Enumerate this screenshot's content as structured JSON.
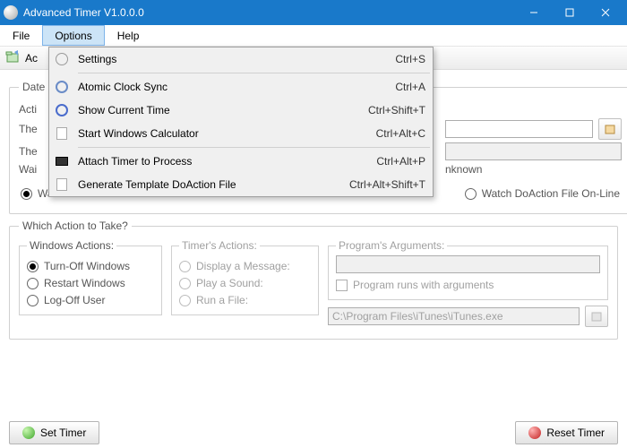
{
  "window": {
    "title": "Advanced Timer V1.0.0.0"
  },
  "menubar": {
    "file": "File",
    "options": "Options",
    "help": "Help"
  },
  "dropdown": {
    "items": [
      {
        "label": "Settings",
        "accel": "Ctrl+S"
      },
      {
        "label": "Atomic Clock Sync",
        "accel": "Ctrl+A"
      },
      {
        "label": "Show Current Time",
        "accel": "Ctrl+Shift+T"
      },
      {
        "label": "Start Windows Calculator",
        "accel": "Ctrl+Alt+C"
      },
      {
        "label": "Attach Timer to Process",
        "accel": "Ctrl+Alt+P"
      },
      {
        "label": "Generate Template DoAction File",
        "accel": "Ctrl+Alt+Shift+T"
      }
    ]
  },
  "toolbar": {
    "label": "Ac"
  },
  "group1": {
    "legend": "Date a",
    "line1_pre": "Acti",
    "line2_pre": "The",
    "line3_pre": "The",
    "line4_pre": "Wai",
    "line4_post": "nknown",
    "radio_local": "Watch Local DoAction File",
    "radio_online": "Watch DoAction File On-Line"
  },
  "group2": {
    "legend": "Which Action to Take?",
    "win_legend": "Windows Actions:",
    "win_turnoff": "Turn-Off Windows",
    "win_restart": "Restart Windows",
    "win_logoff": "Log-Off User",
    "tim_legend": "Timer's Actions:",
    "tim_msg": "Display a Message:",
    "tim_snd": "Play a Sound:",
    "tim_run": "Run a File:",
    "args_legend": "Program's Arguments:",
    "args_chk": "Program runs with arguments",
    "run_path": "C:\\Program Files\\iTunes\\iTunes.exe"
  },
  "buttons": {
    "set": "Set Timer",
    "reset": "Reset Timer"
  }
}
